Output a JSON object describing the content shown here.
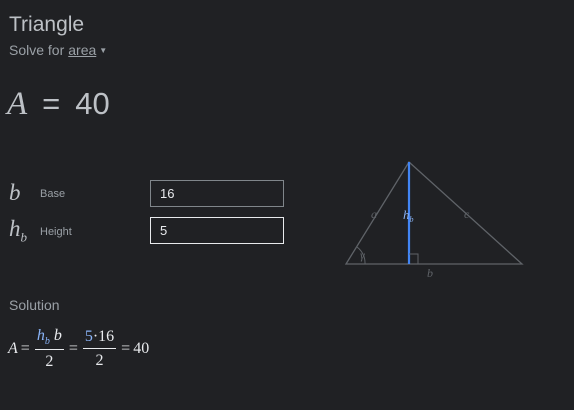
{
  "app": {
    "title": "Triangle",
    "solve_for_prefix": "Solve for",
    "solve_for_value": "area"
  },
  "result": {
    "symbol": "A",
    "equals": "=",
    "value": "40"
  },
  "inputs": [
    {
      "symbol": "b",
      "subscript": "",
      "label": "Base",
      "value": "16"
    },
    {
      "symbol": "h",
      "subscript": "b",
      "label": "Height",
      "value": "5"
    }
  ],
  "diagram": {
    "labels": {
      "a": "a",
      "c": "c",
      "b": "b",
      "h": "h",
      "h_sub": "b",
      "gamma": "γ"
    },
    "colors": {
      "edge": "#5f6368",
      "height_line": "#4285f4",
      "height_label": "#8ab4f8"
    }
  },
  "solution": {
    "label": "Solution",
    "lhs": "A",
    "eq": "=",
    "frac1_num_h": "h",
    "frac1_num_h_sub": "b",
    "frac1_num_b": "b",
    "frac1_den": "2",
    "frac2_num_h": "5",
    "frac2_num_dot": "·",
    "frac2_num_b": "16",
    "frac2_den": "2",
    "result": "40"
  },
  "colors": {
    "background": "#202124",
    "text": "#bdc1c6",
    "accent": "#8ab4f8"
  }
}
